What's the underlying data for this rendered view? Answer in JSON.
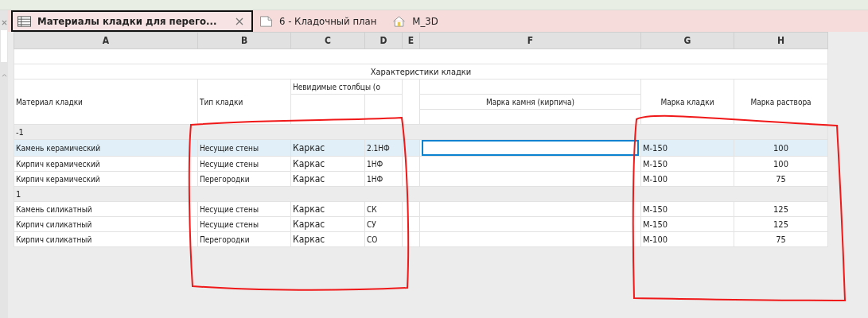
{
  "tabs": [
    {
      "label": "Материалы кладки для перего...",
      "selected": true,
      "kind": "schedule"
    },
    {
      "label": "6 - Кладочный план",
      "selected": false,
      "kind": "sheet"
    },
    {
      "label": "M_3D",
      "selected": false,
      "kind": "house"
    }
  ],
  "column_letters": [
    "A",
    "B",
    "C",
    "D",
    "E",
    "F",
    "G",
    "H"
  ],
  "table": {
    "title": "Характеристики кладки",
    "headers": {
      "material": "Материал кладки",
      "type": "Тип кладки",
      "hidden": "Невидимые столбцы (о",
      "stone_grade": "Марка камня (кирпича)",
      "masonry_grade": "Марка кладки",
      "mortar_grade": "Марка раствора"
    },
    "groups": [
      {
        "label": "-1",
        "rows": [
          {
            "material": "Камень керамический",
            "type": "Несущие стены",
            "frame": "Каркас",
            "format": "2.1НФ",
            "masonry_grade": "М-150",
            "mortar_grade": "100",
            "selected": true
          },
          {
            "material": "Кирпич керамический",
            "type": "Несущие стены",
            "frame": "Каркас",
            "format": "1НФ",
            "masonry_grade": "М-150",
            "mortar_grade": "100",
            "selected": false
          },
          {
            "material": "Кирпич керамический",
            "type": "Перегородки",
            "frame": "Каркас",
            "format": "1НФ",
            "masonry_grade": "М-100",
            "mortar_grade": "75",
            "selected": false
          }
        ]
      },
      {
        "label": "1",
        "rows": [
          {
            "material": "Камень силикатный",
            "type": "Несущие стены",
            "frame": "Каркас",
            "format": "СК",
            "masonry_grade": "М-150",
            "mortar_grade": "125",
            "selected": false
          },
          {
            "material": "Кирпич силикатный",
            "type": "Несущие стены",
            "frame": "Каркас",
            "format": "СУ",
            "masonry_grade": "М-150",
            "mortar_grade": "125",
            "selected": false
          },
          {
            "material": "Кирпич силикатный",
            "type": "Перегородки",
            "frame": "Каркас",
            "format": "СО",
            "masonry_grade": "М-100",
            "mortar_grade": "75",
            "selected": false
          }
        ]
      }
    ]
  }
}
